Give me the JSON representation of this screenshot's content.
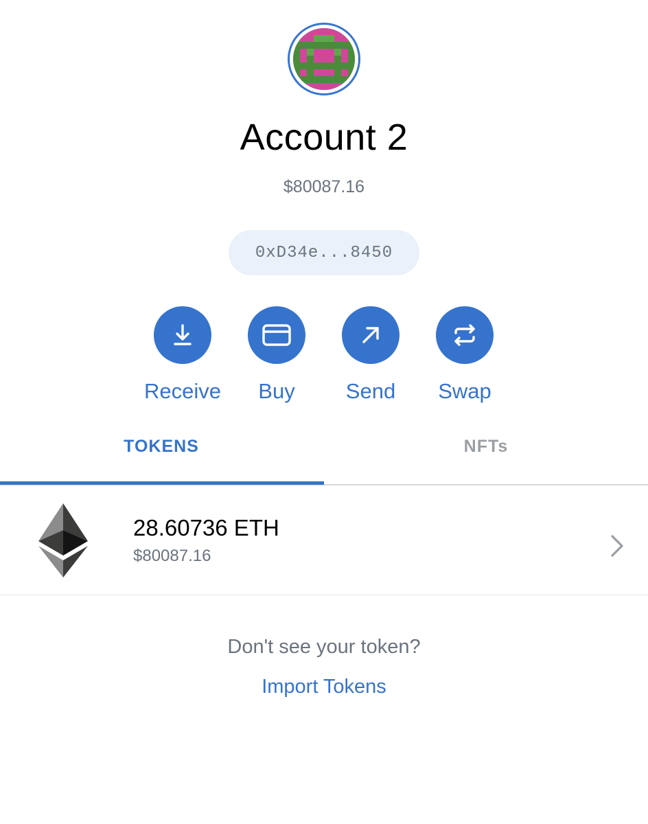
{
  "account": {
    "name": "Account 2",
    "balance": "$80087.16",
    "address": "0xD34e...8450",
    "avatar_icon": "identicon-avatar"
  },
  "actions": [
    {
      "label": "Receive",
      "icon": "download-icon"
    },
    {
      "label": "Buy",
      "icon": "credit-card-icon"
    },
    {
      "label": "Send",
      "icon": "arrow-up-right-icon"
    },
    {
      "label": "Swap",
      "icon": "swap-arrows-icon"
    }
  ],
  "tabs": {
    "tokens": "TOKENS",
    "nfts": "NFTs",
    "active": "tokens"
  },
  "tokens": [
    {
      "amount": "28.60736 ETH",
      "fiat": "$80087.16",
      "icon": "ethereum-icon"
    }
  ],
  "footer": {
    "prompt": "Don't see your token?",
    "import_label": "Import Tokens"
  },
  "colors": {
    "accent": "#3673cc",
    "muted_text": "#6a737d",
    "pill_bg": "#eaf1fa",
    "avatar_pink": "#d0479a",
    "avatar_green": "#4a8c3a"
  }
}
